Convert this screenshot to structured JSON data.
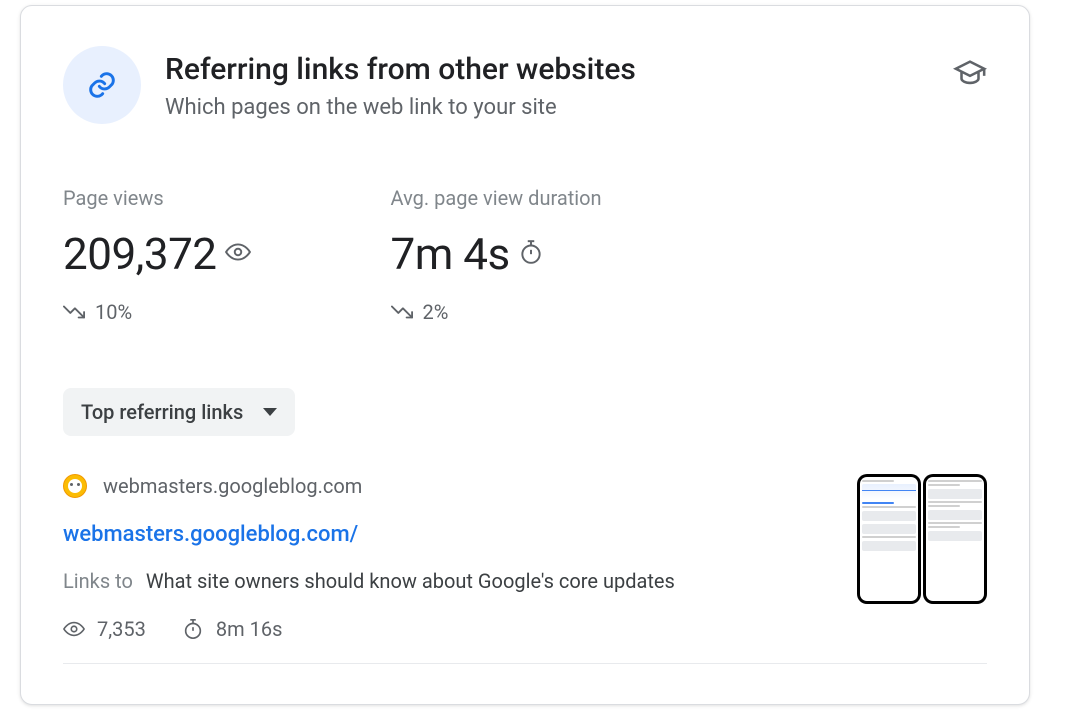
{
  "header": {
    "title": "Referring links from other websites",
    "subtitle": "Which pages on the web link to your site"
  },
  "metrics": {
    "page_views": {
      "label": "Page views",
      "value": "209,372",
      "trend": "10%"
    },
    "duration": {
      "label": "Avg. page view duration",
      "value": "7m 4s",
      "trend": "2%"
    }
  },
  "dropdown": {
    "label": "Top referring links"
  },
  "items": [
    {
      "domain": "webmasters.googleblog.com",
      "url": "webmasters.googleblog.com/",
      "links_to_label": "Links to",
      "links_to_value": "What site owners should know about Google's core updates",
      "views": "7,353",
      "duration": "8m 16s"
    }
  ]
}
